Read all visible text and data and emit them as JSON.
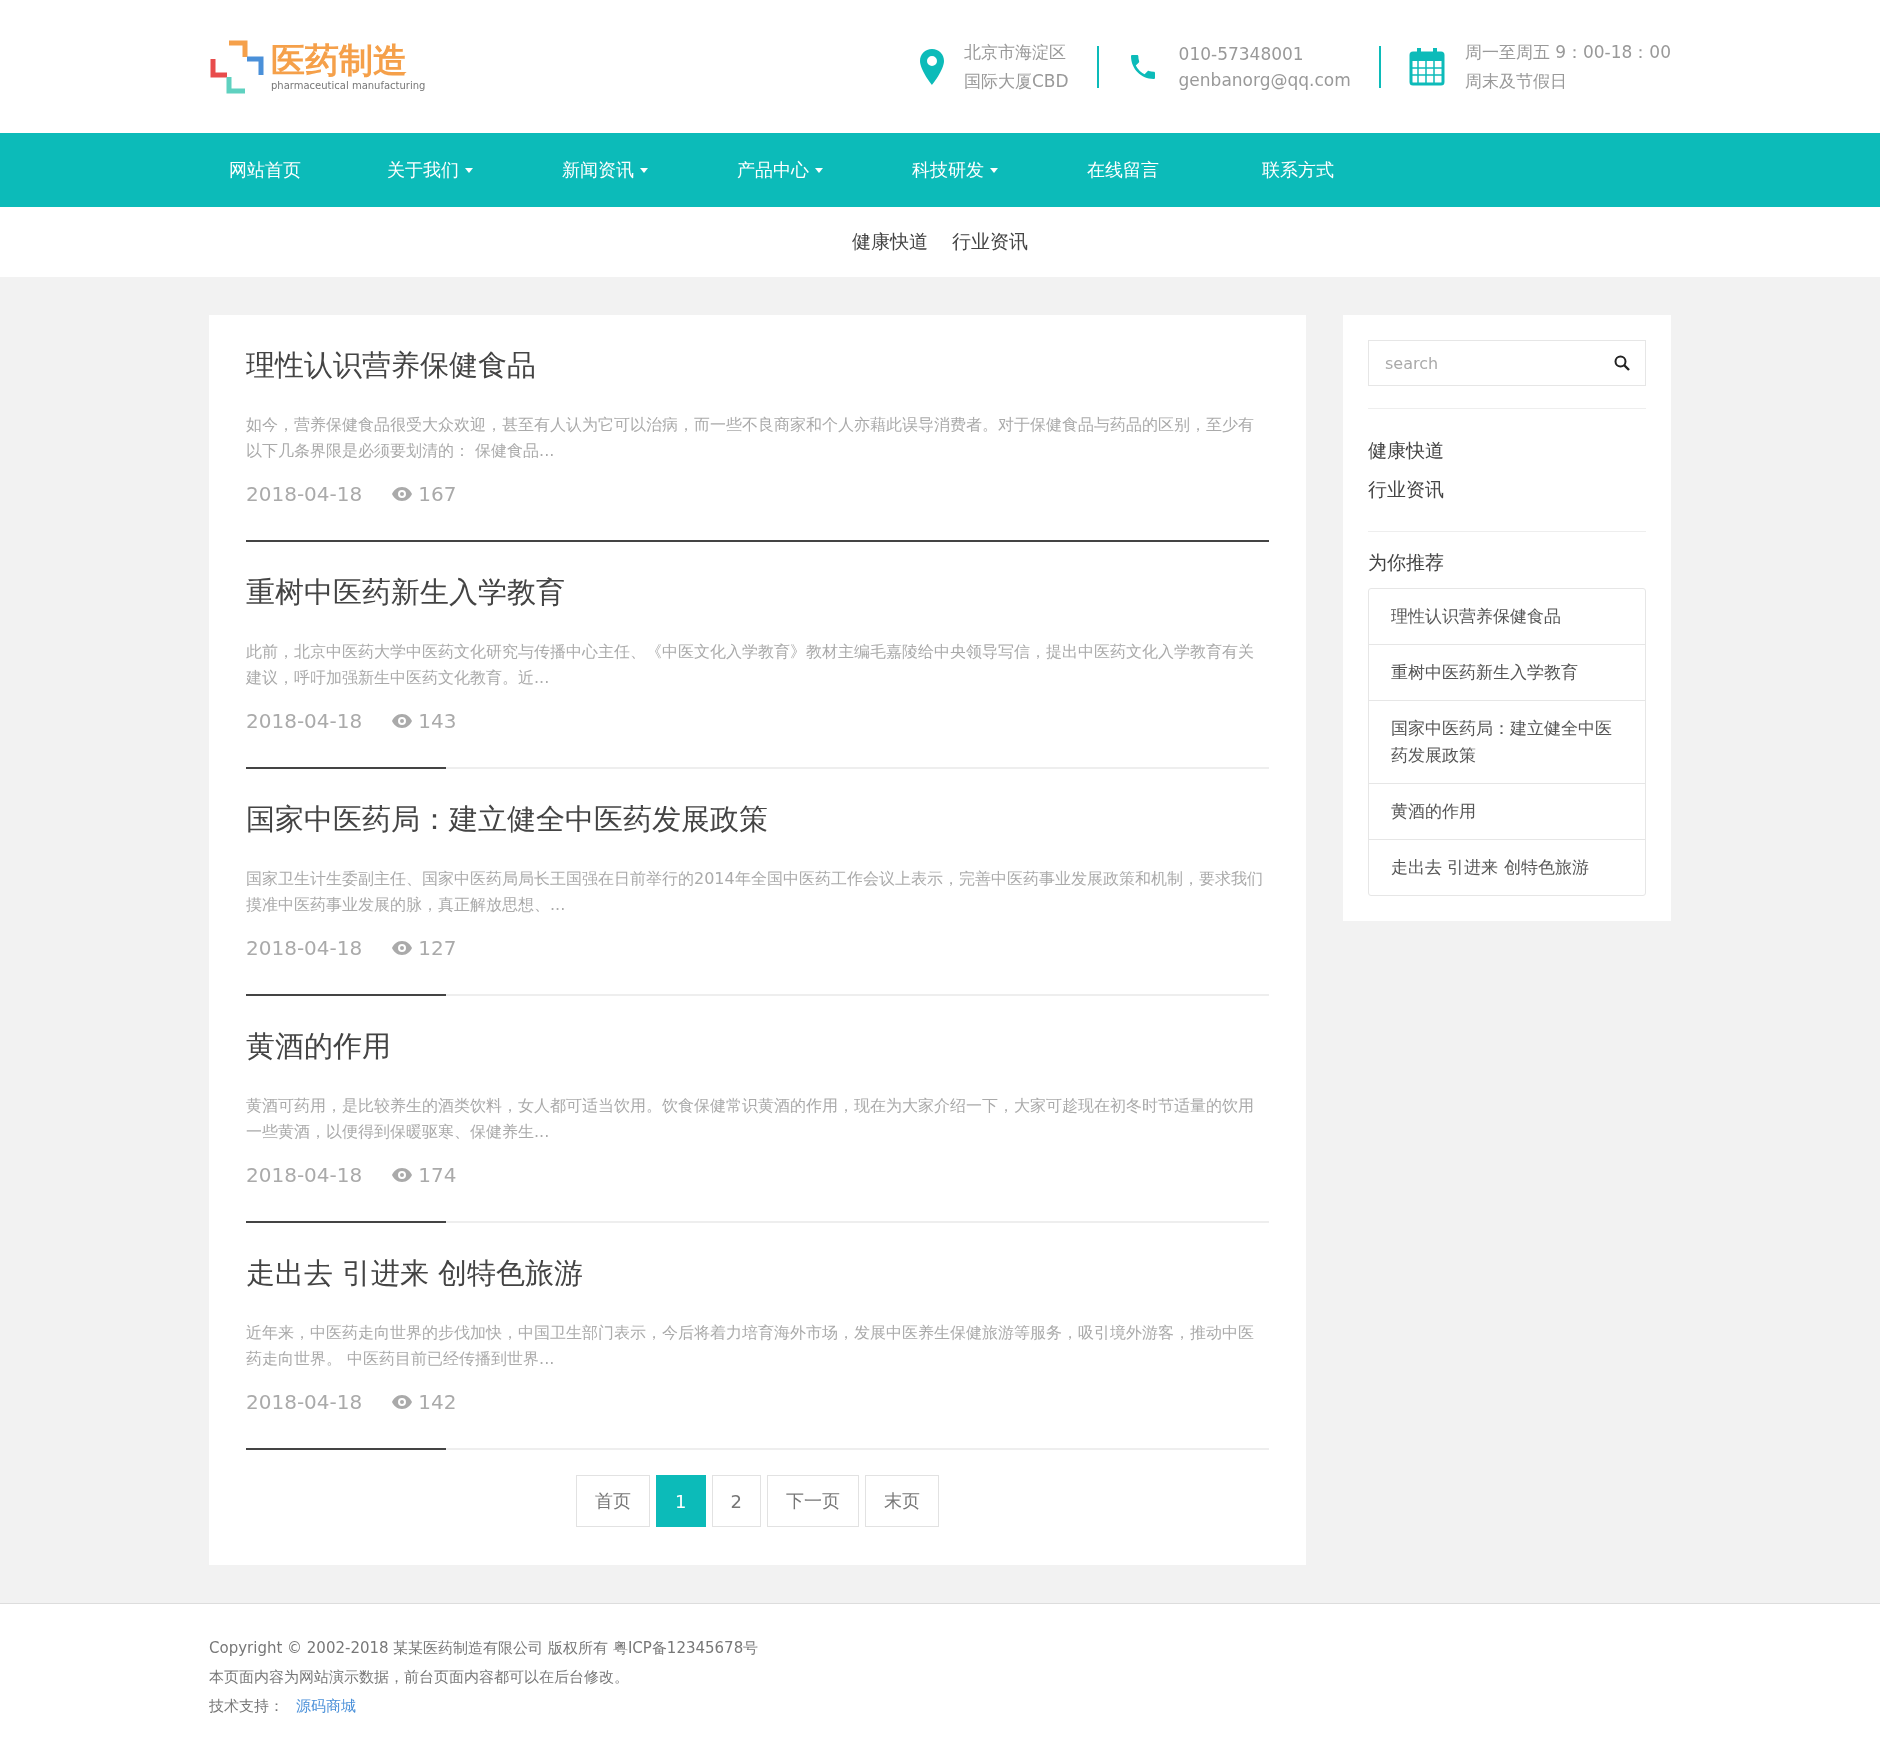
{
  "header": {
    "logo": {
      "title": "医药制造",
      "subtitle": "pharmaceutical manufacturing"
    },
    "contacts": [
      {
        "kind": "location",
        "lines": [
          "北京市海淀区",
          "国际大厦CBD"
        ]
      },
      {
        "kind": "phone",
        "lines": [
          "010-57348001",
          "genbanorg@qq.com"
        ]
      },
      {
        "kind": "calendar",
        "lines": [
          "周一至周五 9：00-18：00",
          "周末及节假日"
        ]
      }
    ]
  },
  "nav": [
    {
      "label": "网站首页",
      "dropdown": false
    },
    {
      "label": "关于我们",
      "dropdown": true
    },
    {
      "label": "新闻资讯",
      "dropdown": true
    },
    {
      "label": "产品中心",
      "dropdown": true
    },
    {
      "label": "科技研发",
      "dropdown": true
    },
    {
      "label": "在线留言",
      "dropdown": false
    },
    {
      "label": "联系方式",
      "dropdown": false
    }
  ],
  "subnav": [
    "健康快道",
    "行业资讯"
  ],
  "articles": [
    {
      "title": "理性认识营养保健食品",
      "summary": "如今，营养保健食品很受大众欢迎，甚至有人认为它可以治病，而一些不良商家和个人亦藉此误导消费者。对于保健食品与药品的区别，至少有以下几条界限是必须要划清的： 保健食品...",
      "date": "2018-04-18",
      "views": "167",
      "active": true
    },
    {
      "title": "重树中医药新生入学教育",
      "summary": "此前，北京中医药大学中医药文化研究与传播中心主任、《中医文化入学教育》教材主编毛嘉陵给中央领导写信，提出中医药文化入学教育有关建议，呼吁加强新生中医药文化教育。近...",
      "date": "2018-04-18",
      "views": "143",
      "active": false
    },
    {
      "title": "国家中医药局：建立健全中医药发展政策",
      "summary": "国家卫生计生委副主任、国家中医药局局长王国强在日前举行的2014年全国中医药工作会议上表示，完善中医药事业发展政策和机制，要求我们摸准中医药事业发展的脉，真正解放思想、...",
      "date": "2018-04-18",
      "views": "127",
      "active": false
    },
    {
      "title": "黄酒的作用",
      "summary": "黄酒可药用，是比较养生的酒类饮料，女人都可适当饮用。饮食保健常识黄酒的作用，现在为大家介绍一下，大家可趁现在初冬时节适量的饮用一些黄酒，以便得到保暖驱寒、保健养生...",
      "date": "2018-04-18",
      "views": "174",
      "active": false
    },
    {
      "title": "走出去 引进来 创特色旅游",
      "summary": "近年来，中医药走向世界的步伐加快，中国卫生部门表示，今后将着力培育海外市场，发展中医养生保健旅游等服务，吸引境外游客，推动中医药走向世界。 中医药目前已经传播到世界...",
      "date": "2018-04-18",
      "views": "142",
      "active": false
    }
  ],
  "pagination": [
    {
      "label": "首页",
      "selected": false
    },
    {
      "label": "1",
      "selected": true
    },
    {
      "label": "2",
      "selected": false
    },
    {
      "label": "下一页",
      "selected": false
    },
    {
      "label": "末页",
      "selected": false
    }
  ],
  "sidebar": {
    "search": {
      "placeholder": "search"
    },
    "categories": [
      "健康快道",
      "行业资讯"
    ],
    "recommend_title": "为你推荐",
    "recommend": [
      "理性认识营养保健食品",
      "重树中医药新生入学教育",
      "国家中医药局：建立健全中医药发展政策",
      "黄酒的作用",
      "走出去 引进来 创特色旅游"
    ]
  },
  "footer": {
    "copyright": "Copyright © 2002-2018 某某医药制造有限公司 版权所有 粤ICP备12345678号",
    "note": "本页面内容为网站演示数据，前台页面内容都可以在后台修改。",
    "support_label": "技术支持：",
    "support_link": "源码商城"
  }
}
